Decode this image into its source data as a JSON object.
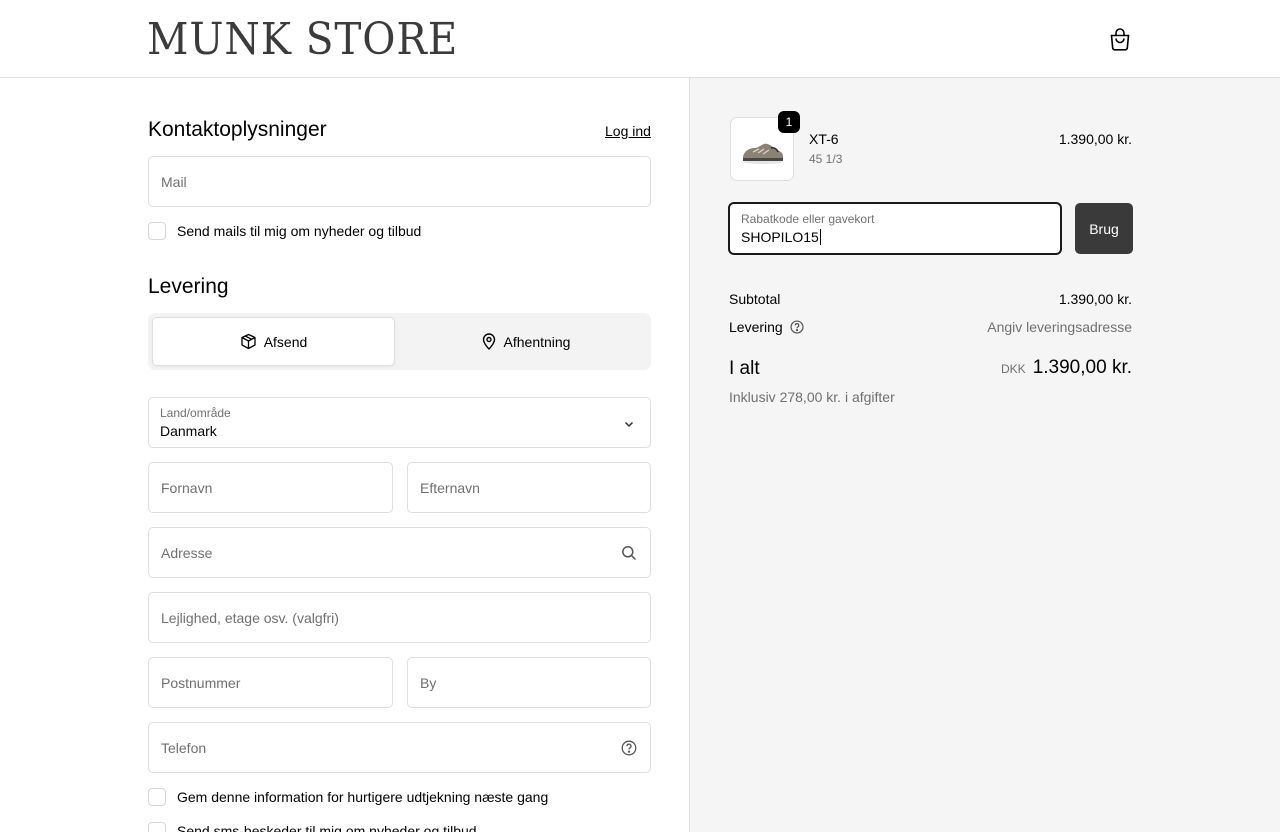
{
  "header": {
    "store_name": "MUNK STORE",
    "cart_icon": "shopping-bag-icon"
  },
  "contact": {
    "title": "Kontaktoplysninger",
    "login_link": "Log ind",
    "email_placeholder": "Mail",
    "newsletter_label": "Send mails til mig om nyheder og tilbud",
    "newsletter_checked": false
  },
  "delivery": {
    "title": "Levering",
    "options": [
      {
        "label": "Afsend",
        "icon": "package-icon",
        "selected": true
      },
      {
        "label": "Afhentning",
        "icon": "map-pin-icon",
        "selected": false
      }
    ],
    "country_label": "Land/område",
    "country_value": "Danmark",
    "first_name_placeholder": "Fornavn",
    "last_name_placeholder": "Efternavn",
    "address_placeholder": "Adresse",
    "apartment_placeholder": "Lejlighed, etage osv. (valgfri)",
    "postal_placeholder": "Postnummer",
    "city_placeholder": "By",
    "phone_placeholder": "Telefon",
    "save_info_label": "Gem denne information for hurtigere udtjekning næste gang",
    "sms_label": "Send sms-beskeder til mig om nyheder og tilbud"
  },
  "summary": {
    "product": {
      "name": "XT-6",
      "variant": "45 1/3",
      "price": "1.390,00 kr.",
      "quantity": "1"
    },
    "discount": {
      "label": "Rabatkode eller gavekort",
      "value": "SHOPILO15",
      "apply_label": "Brug"
    },
    "subtotal_label": "Subtotal",
    "subtotal_value": "1.390,00 kr.",
    "shipping_label": "Levering",
    "shipping_value": "Angiv leveringsadresse",
    "total_label": "I alt",
    "currency": "DKK",
    "total_value": "1.390,00 kr.",
    "tax_note": "Inklusiv 278,00 kr. i afgifter"
  },
  "colors": {
    "accent": "#000000",
    "button_dark": "#3a3a3a",
    "summary_bg": "#f5f5f5",
    "muted_text": "#707070",
    "border": "#dedede"
  }
}
